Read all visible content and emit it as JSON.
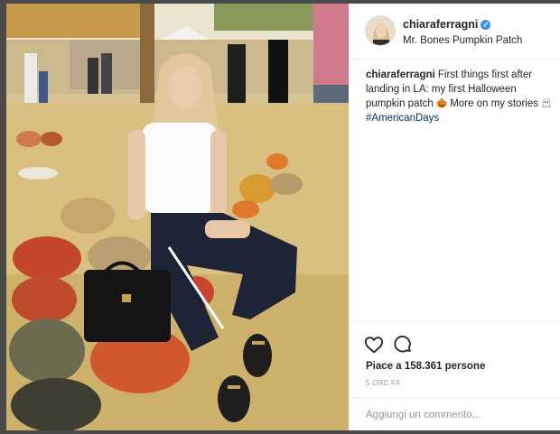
{
  "post": {
    "username": "chiaraferragni",
    "location": "Mr. Bones Pumpkin Patch",
    "caption": {
      "user": "chiaraferragni",
      "text_before_emoji": "First things first after landing in LA: my first Halloween pumpkin patch",
      "text_after_emoji": "More on my stories",
      "hashtag": "#AmericanDays"
    },
    "likes": "Piace a 158.361 persone",
    "time": "5 ORE FA",
    "comment_placeholder": "Aggiungi un commento..."
  },
  "icons": {
    "verified": "verified-badge-icon",
    "pumpkin_emoji": "jack-o-lantern-emoji",
    "ghost_emoji": "ghost-emoji",
    "like": "heart-icon",
    "comment": "comment-bubble-icon"
  },
  "colors": {
    "verified_blue": "#3897f0",
    "hashtag_blue": "#003569",
    "text": "#262626",
    "muted": "#999999"
  }
}
